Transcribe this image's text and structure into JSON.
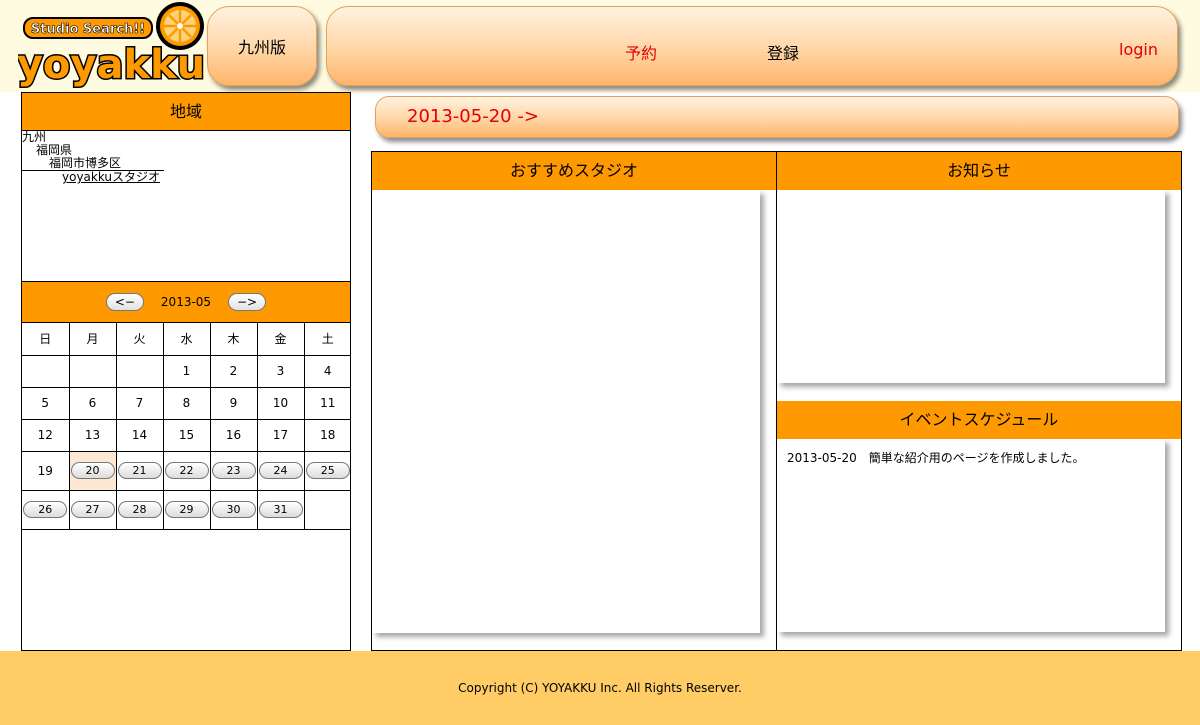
{
  "header": {
    "logo_line1": "Studio Search!!",
    "logo_line2": "yoyakku",
    "region_button": "九州版",
    "nav": {
      "reserve": "予約",
      "register": "登録",
      "login": "login"
    }
  },
  "area": {
    "title": "地域",
    "tree": [
      "九州",
      "福岡県",
      "福岡市博多区",
      "yoyakkuスタジオ"
    ]
  },
  "calendar": {
    "prev": "<−",
    "month": "2013-05",
    "next": "−>",
    "weekdays": [
      "日",
      "月",
      "火",
      "水",
      "木",
      "金",
      "土"
    ],
    "weeks": [
      [
        "",
        "",
        "",
        "1",
        "2",
        "3",
        "4"
      ],
      [
        "5",
        "6",
        "7",
        "8",
        "9",
        "10",
        "11"
      ],
      [
        "12",
        "13",
        "14",
        "15",
        "16",
        "17",
        "18"
      ],
      [
        "19",
        "20",
        "21",
        "22",
        "23",
        "24",
        "25"
      ],
      [
        "26",
        "27",
        "28",
        "29",
        "30",
        "31",
        ""
      ]
    ],
    "selected_day": "20"
  },
  "date_bar": {
    "label": "2013-05-20 ->"
  },
  "panels": {
    "studio_title": "おすすめスタジオ",
    "news_title": "お知らせ",
    "event_title": "イベントスケジュール",
    "event_items": [
      {
        "date": "2013-05-20",
        "text": "簡単な紹介用のページを作成しました。"
      }
    ]
  },
  "footer": {
    "copyright": "Copyright (C) YOYAKKU Inc. All Rights Reserver."
  },
  "colors": {
    "accent_orange": "#ff9900",
    "footer": "#ffcc66",
    "link_red": "#e60000",
    "header_bg": "#fffbe0"
  }
}
